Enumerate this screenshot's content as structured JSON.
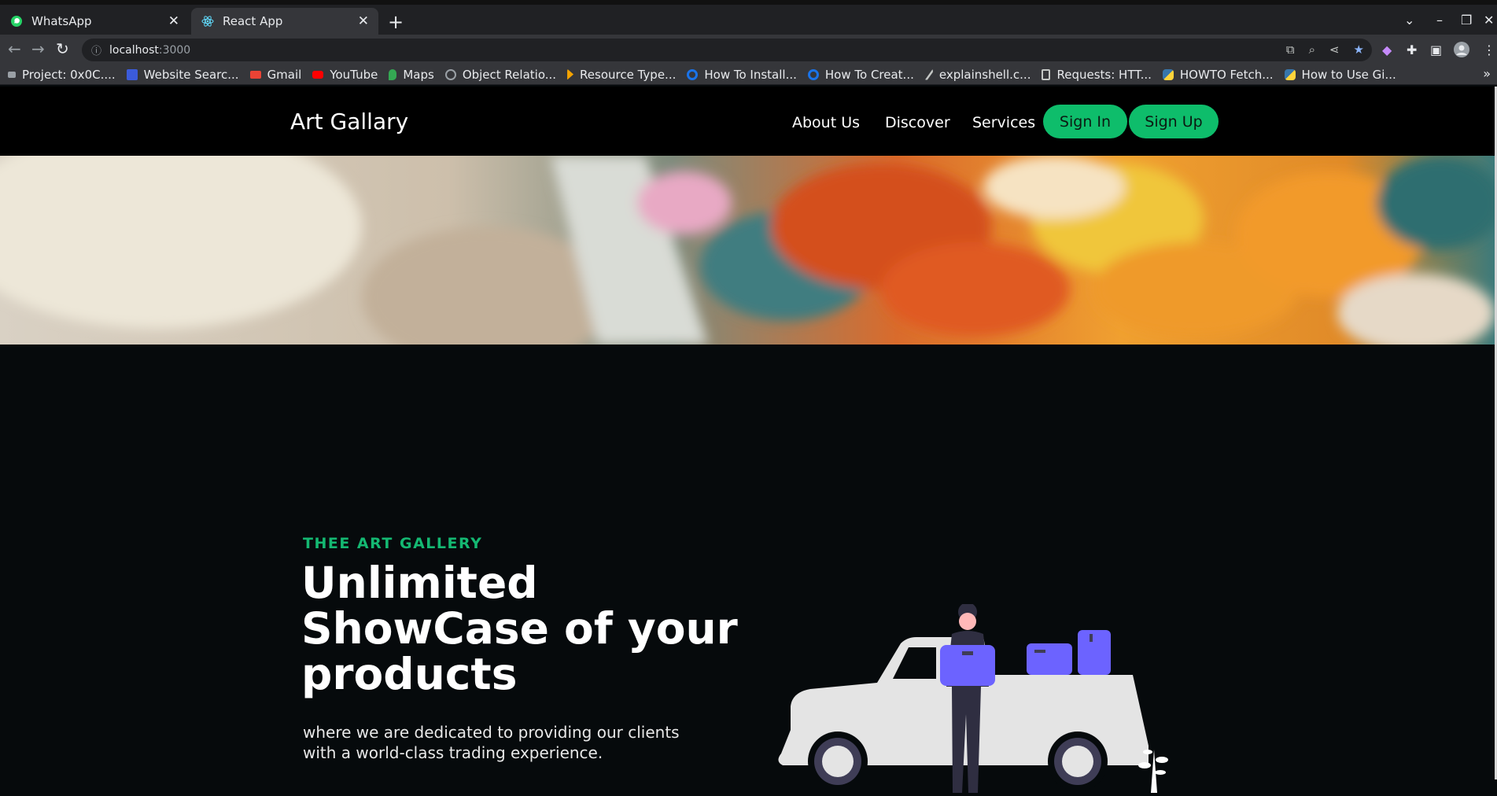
{
  "browser": {
    "tabs": [
      {
        "title": "WhatsApp",
        "icon": "whatsapp-icon",
        "active": false
      },
      {
        "title": "React App",
        "icon": "react-icon",
        "active": true
      }
    ],
    "url_host": "localhost",
    "url_port": ":3000",
    "bookmarks": [
      {
        "label": "Project: 0x0C....",
        "icon": "alx-icon",
        "color": "#9aa0a6"
      },
      {
        "label": "Website Searc...",
        "icon": "jw-icon",
        "color": "#3b5bdb"
      },
      {
        "label": "Gmail",
        "icon": "gmail-icon",
        "color": "#ea4335"
      },
      {
        "label": "YouTube",
        "icon": "youtube-icon",
        "color": "#ff0000"
      },
      {
        "label": "Maps",
        "icon": "maps-icon",
        "color": "#34a853"
      },
      {
        "label": "Object Relatio...",
        "icon": "circle-icon",
        "color": "#9aa0a6"
      },
      {
        "label": "Resource Type...",
        "icon": "arrow-icon",
        "color": "#f4a300"
      },
      {
        "label": "How To Install...",
        "icon": "do-icon",
        "color": "#1a73e8"
      },
      {
        "label": "How To Creat...",
        "icon": "do-icon",
        "color": "#1a73e8"
      },
      {
        "label": "explainshell.c...",
        "icon": "shell-icon",
        "color": "#c4c7c5"
      },
      {
        "label": "Requests: HTT...",
        "icon": "doc-icon",
        "color": "#c4c7c5"
      },
      {
        "label": "HOWTO Fetch...",
        "icon": "python-icon",
        "color": "#3776ab"
      },
      {
        "label": "How to Use Gi...",
        "icon": "python-icon",
        "color": "#3776ab"
      }
    ]
  },
  "site": {
    "logo": "Art Gallary",
    "nav": [
      "About Us",
      "Discover",
      "Services"
    ],
    "sign_in": "Sign In",
    "sign_up": "Sign Up",
    "accent": "#0ebd6b",
    "hero": {
      "eyebrow": "THEE ART GALLERY",
      "headline": "Unlimited ShowCase of your products",
      "subtext": "where we are dedicated to providing our clients with a world-class trading experience."
    }
  }
}
